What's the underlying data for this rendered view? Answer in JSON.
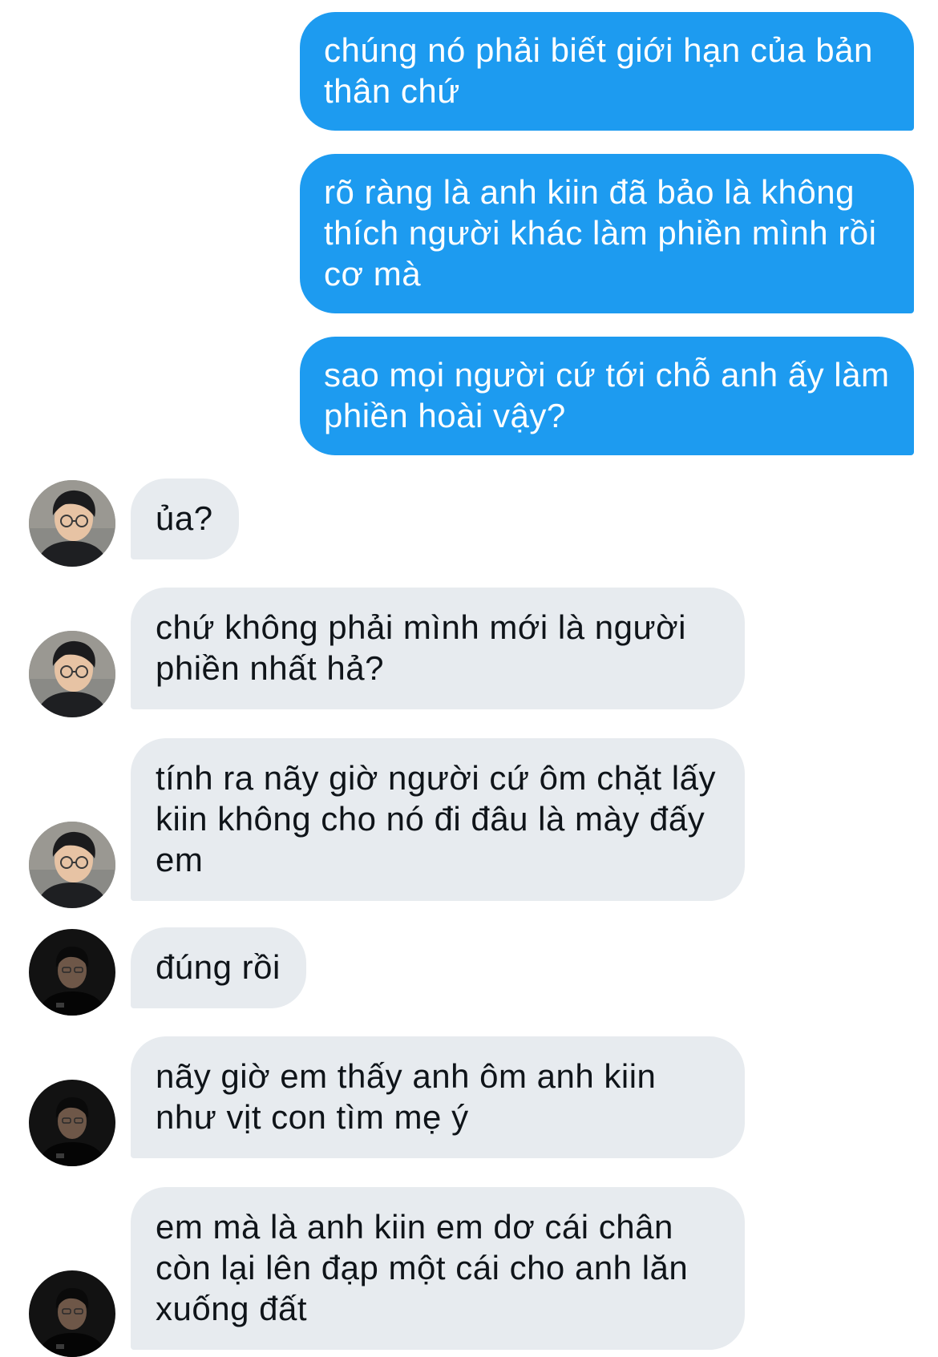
{
  "conversation": {
    "sent_messages": [
      "chúng nó phải biết giới hạn của bản thân chứ",
      "rõ ràng là anh kiin đã bảo là không thích người khác làm phiền mình rồi cơ mà",
      "sao mọi người cứ tới chỗ anh ấy làm phiền hoài vậy?"
    ],
    "received_messages": [
      "ủa?",
      "chứ không phải mình mới là người phiền nhất hả?",
      "tính ra nãy giờ người cứ ôm chặt lấy kiin không cho nó đi đâu là mày đấy em",
      "đúng rồi",
      "nãy giờ em thấy anh ôm anh kiin như vịt con tìm mẹ ý",
      "em mà là anh kiin em dơ cái chân còn lại lên đạp một cái cho anh lăn xuống đất"
    ]
  },
  "colors": {
    "sent_bubble": "#1d9bf0",
    "received_bubble": "#e7ebef",
    "sent_text": "#ffffff",
    "received_text": "#0f1419"
  },
  "icons": {
    "avatar_a": "user-avatar-glasses-icon",
    "avatar_b": "user-avatar-dark-icon"
  }
}
